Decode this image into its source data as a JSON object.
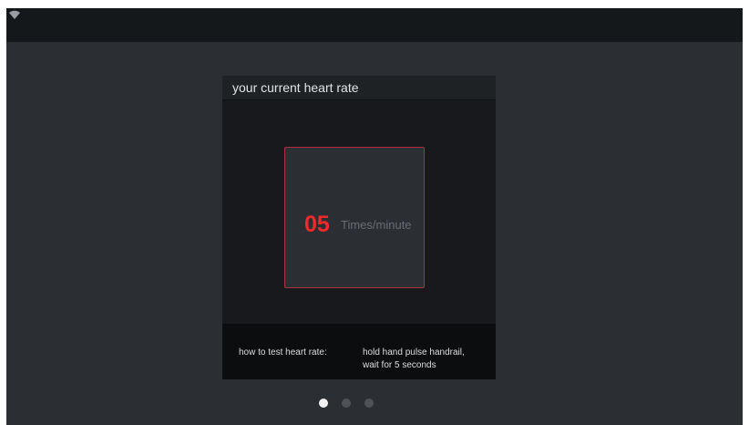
{
  "status_bar": {
    "wifi_icon": "wifi-icon"
  },
  "card": {
    "title": "your current heart rate",
    "heart_rate": {
      "value": "05",
      "unit": "Times/minute",
      "value_color": "#ef2a2a",
      "border_color": "#b03040"
    },
    "instructions": {
      "label": "how to test heart rate:",
      "line1": "hold hand pulse handrail,",
      "line2": "wait for 5 seconds"
    }
  },
  "pager": {
    "pages": 3,
    "active_page": 1
  }
}
